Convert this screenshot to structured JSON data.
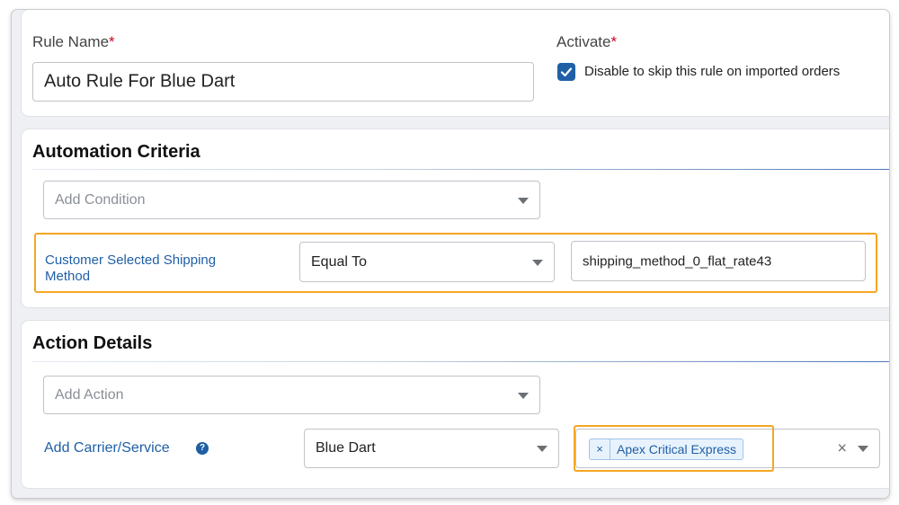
{
  "rule": {
    "name_label": "Rule Name",
    "name_required": "*",
    "name_value": "Auto Rule For Blue Dart",
    "activate_label": "Activate",
    "activate_required": "*",
    "activate_checked": true,
    "activate_text": "Disable to skip this rule on imported orders"
  },
  "criteria": {
    "title": "Automation Criteria",
    "add_condition_placeholder": "Add Condition",
    "condition": {
      "field_label": "Customer Selected Shipping Method",
      "operator": "Equal To",
      "value": "shipping_method_0_flat_rate43"
    }
  },
  "action": {
    "title": "Action Details",
    "add_action_placeholder": "Add Action",
    "carrier_label": "Add Carrier/Service",
    "help_icon": "?",
    "carrier_value": "Blue Dart",
    "service_tag": "Apex Critical Express",
    "tag_remove": "×",
    "clear": "×"
  },
  "colors": {
    "accent": "#1f5fa6",
    "highlight": "#f5a623",
    "required": "#d0021b"
  }
}
